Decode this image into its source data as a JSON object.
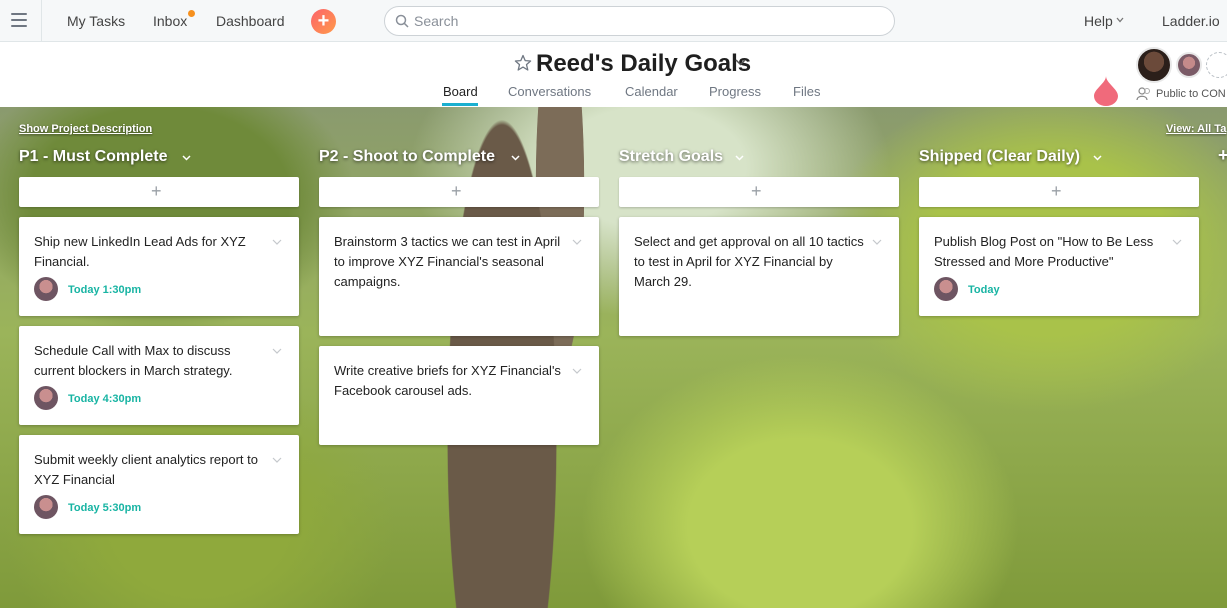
{
  "topnav": {
    "my_tasks": "My Tasks",
    "inbox": "Inbox",
    "dashboard": "Dashboard",
    "add_label": "+",
    "search_placeholder": "Search",
    "help": "Help",
    "org": "Ladder.io"
  },
  "project": {
    "title": "Reed's Daily Goals",
    "tabs": [
      "Board",
      "Conversations",
      "Calendar",
      "Progress",
      "Files"
    ],
    "active_tab": "Board",
    "public_label": "Public to CON"
  },
  "board": {
    "show_description": "Show Project Description",
    "view_all": "View: All Ta",
    "add_column": "+",
    "add_card": "+",
    "columns": [
      {
        "title": "P1 - Must Complete",
        "cards": [
          {
            "text": "Ship new LinkedIn Lead Ads for XYZ Financial.",
            "due": "Today 1:30pm"
          },
          {
            "text": "Schedule Call with Max to discuss current blockers in March strategy.",
            "due": "Today 4:30pm"
          },
          {
            "text": "Submit weekly client analytics report to XYZ Financial",
            "due": "Today 5:30pm"
          }
        ]
      },
      {
        "title": "P2 - Shoot to Complete",
        "cards": [
          {
            "text": "Brainstorm 3 tactics we can test in April to improve XYZ Financial's seasonal campaigns."
          },
          {
            "text": "Write creative briefs for XYZ Financial's Facebook carousel ads."
          }
        ]
      },
      {
        "title": "Stretch Goals",
        "cards": [
          {
            "text": "Select and get approval on all 10 tactics to test in April for XYZ Financial by March 29."
          }
        ]
      },
      {
        "title": "Shipped (Clear Daily)",
        "cards": [
          {
            "text": "Publish Blog Post on \"How to Be Less Stressed and More Productive\"",
            "due": "Today"
          }
        ]
      }
    ]
  },
  "colors": {
    "accent_tab": "#1aafd0",
    "due_today": "#18b4a3",
    "add_button": "#fc636b",
    "inbox_dot": "#f6901e",
    "help_drip": "#f06a7b"
  }
}
